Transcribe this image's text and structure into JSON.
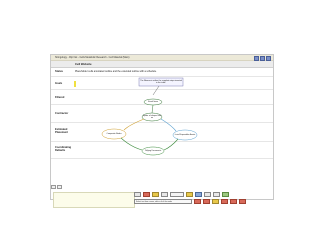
{
  "window": {
    "title": "Stringology - Flip Net - Cells Metabolic Research - Cell Material (Main)"
  },
  "header": {
    "title": "Cell Website"
  },
  "rows": [
    {
      "label": "Status",
      "text": "Placeholder cells annotated outline and the extended outline with a schedule."
    },
    {
      "label": "Goals",
      "text": ""
    },
    {
      "label": "Filtered",
      "text": ""
    },
    {
      "label": "Contractor",
      "text": ""
    },
    {
      "label": "Estimated Placement",
      "text": ""
    },
    {
      "label": "Coordinating Defaults",
      "text": ""
    }
  ],
  "diagram": {
    "callout": "The Fibonacci outline the complete steps inserted in the table.",
    "nodes": {
      "top": "Visual Items",
      "center": "Spider of shapes hold on",
      "left": "Composite Nodes",
      "right": "Lucid Disposable Assets",
      "bottom": "Tallying Documents"
    },
    "colors": {
      "top_to_center": "#3a7a3a",
      "center_to_left": "#d0a030",
      "center_to_right": "#5aa0d0",
      "left_to_bottom": "#3a8a3a",
      "right_to_bottom": "#3a8a3a",
      "callout_arrow": "#444444"
    }
  },
  "toolbar": {
    "status_text": "Select text from cursor, edit or click the mode"
  }
}
